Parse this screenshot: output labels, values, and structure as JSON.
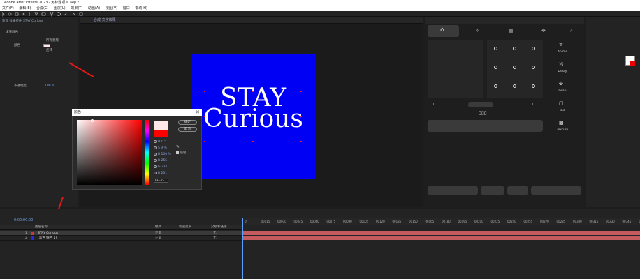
{
  "app": {
    "title": "Adobe After Effects 2023 - 无标题项目.aep *",
    "menu": [
      "文件(F)",
      "编辑(E)",
      "合成(C)",
      "图层(L)",
      "效果(T)",
      "动画(A)",
      "视图(V)",
      "窗口",
      "帮助(H)"
    ]
  },
  "project_panel": {
    "rows": [
      "项目 效果控件 STAY Curious",
      "填充颜色",
      "颜色",
      "所有蒙版",
      "反转",
      "不透明度"
    ],
    "opacity_value": "100 %"
  },
  "viewer": {
    "tab": "合成 文字效果",
    "comp_text_line1": "STAY",
    "comp_text_line2": "Curious",
    "comp_bg_color": "#0000f5"
  },
  "color_dialog": {
    "title": "颜色",
    "ok_label": "确定",
    "cancel_label": "取消",
    "eyedropper_label": "吸管",
    "fields": [
      {
        "label": "H",
        "value": "0 °"
      },
      {
        "label": "S",
        "value": "9 %"
      },
      {
        "label": "B",
        "value": "100 %"
      },
      {
        "label": "R",
        "value": "255"
      },
      {
        "label": "G",
        "value": "231"
      },
      {
        "label": "B",
        "value": "231"
      }
    ],
    "hex": "FFE7E7",
    "new_color": "#ffe7e7",
    "old_color": "#ff0000"
  },
  "right_panel": {
    "side_items": [
      "Anime",
      "Delay",
      "Grab",
      "Null",
      "Texture"
    ],
    "left_value": "0",
    "right_value": "0"
  },
  "timeline": {
    "timecode": "0:00:00:00",
    "columns": [
      "图层名称",
      "模式",
      "T",
      "轨道遮罩",
      "父级和链接"
    ],
    "layers": [
      {
        "num": "1",
        "name": "STAY Curious",
        "mode": "正常",
        "parent": "无",
        "color": "#c73a3a"
      },
      {
        "num": "2",
        "name": "[蓝色 纯色 1]",
        "mode": "正常",
        "parent": "无",
        "color": "#2a2ad6"
      }
    ],
    "ruler_ticks": [
      "0f",
      "00015",
      "00030",
      "00045",
      "00060",
      "00075",
      "00090",
      "00105",
      "00120",
      "00135",
      "00150",
      "00165",
      "00180",
      "00195",
      "00210",
      "00225",
      "00240",
      "00255",
      "00270",
      "00285",
      "00300",
      "00315",
      "00330",
      "00345",
      "00360"
    ]
  }
}
